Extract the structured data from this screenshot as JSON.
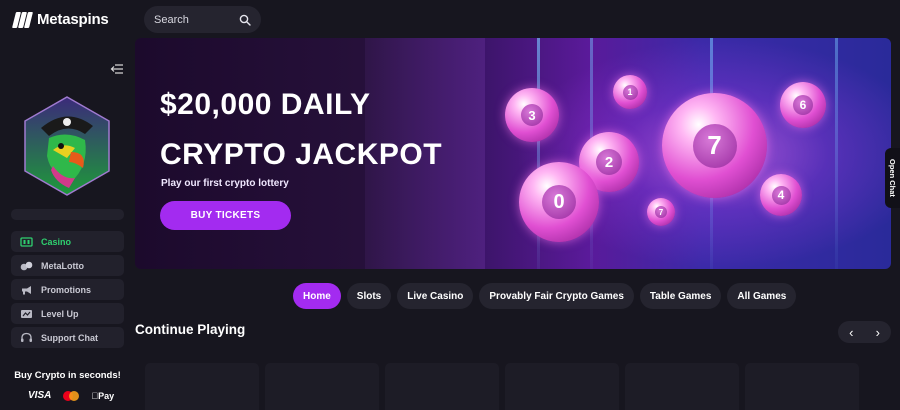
{
  "brand": {
    "name": "Metaspins"
  },
  "search": {
    "placeholder": "Search",
    "icon": "search-icon"
  },
  "sidebar": {
    "nav": [
      {
        "label": "Casino",
        "icon": "casino-icon",
        "active": true
      },
      {
        "label": "MetaLotto",
        "icon": "lotto-icon"
      },
      {
        "label": "Promotions",
        "icon": "megaphone-icon"
      },
      {
        "label": "Level Up",
        "icon": "level-up-icon"
      },
      {
        "label": "Support Chat",
        "icon": "headset-icon"
      }
    ],
    "buy_crypto": "Buy Crypto in seconds!",
    "payments": {
      "visa": "VISA",
      "apple_pay": "Pay"
    }
  },
  "banner": {
    "title_line1": "$20,000 DAILY",
    "title_line2": "CRYPTO JACKPOT",
    "subtitle": "Play our first crypto lottery",
    "cta": "BUY TICKETS",
    "balls": [
      "3",
      "1",
      "2",
      "7",
      "6",
      "0",
      "7",
      "4"
    ]
  },
  "open_chat": "Open Chat",
  "tabs": [
    "Home",
    "Slots",
    "Live Casino",
    "Provably Fair Crypto Games",
    "Table Games",
    "All Games"
  ],
  "section": {
    "title": "Continue Playing",
    "prev": "‹",
    "next": "›"
  },
  "colors": {
    "accent": "#a32bf0",
    "active_nav": "#2fd06f",
    "background": "#17161f"
  }
}
